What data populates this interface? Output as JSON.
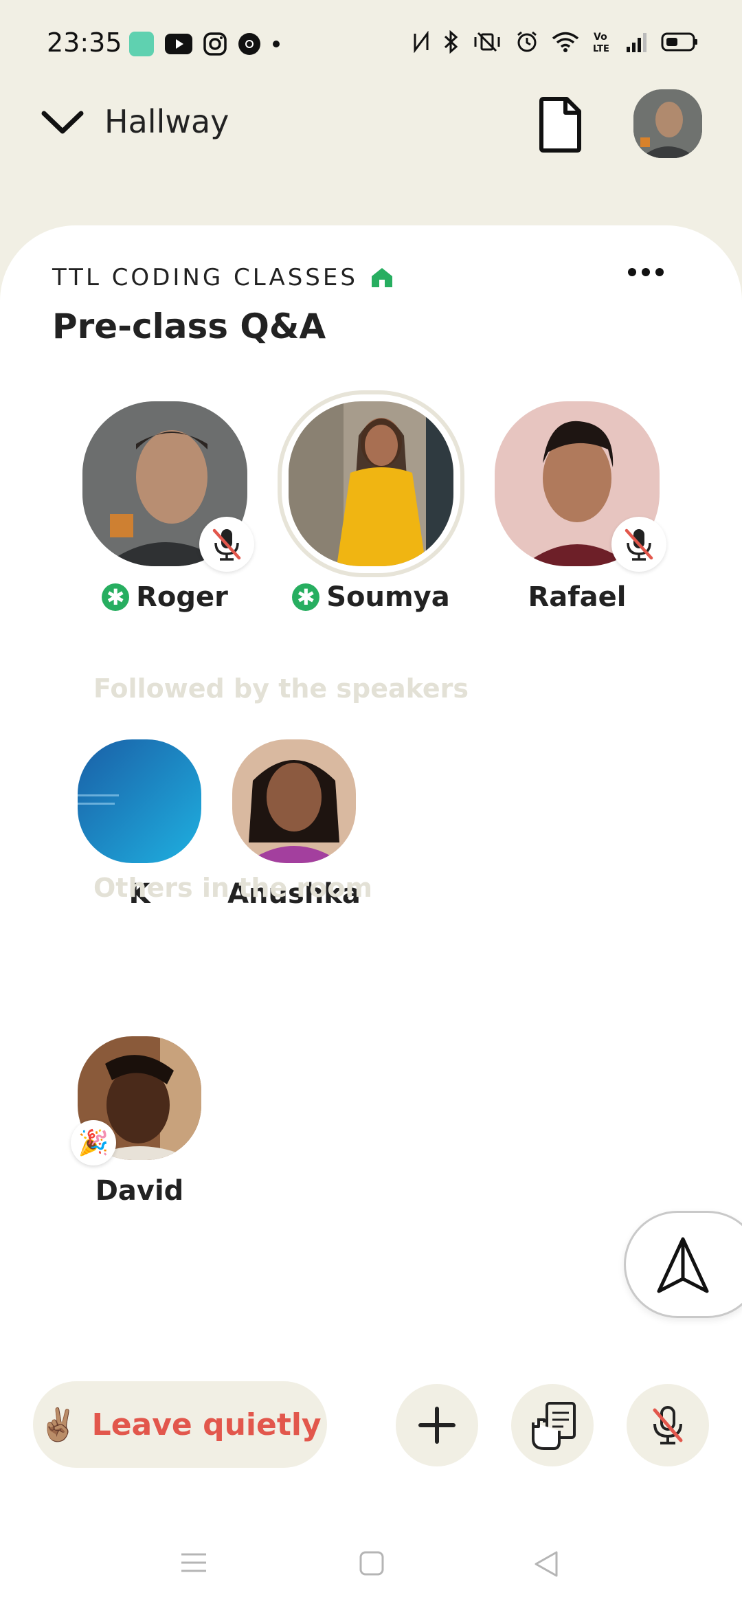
{
  "status_bar": {
    "time": "23:35",
    "app_icons": [
      "chat-app-icon",
      "youtube-icon",
      "instagram-icon",
      "chrome-icon",
      "more-dot-icon"
    ],
    "system_icons": [
      "nfc-icon",
      "bluetooth-icon",
      "vibrate-off-icon",
      "alarm-icon",
      "wifi-icon",
      "volte-icon",
      "signal-icon",
      "battery-icon"
    ]
  },
  "header": {
    "hallway_label": "Hallway"
  },
  "room": {
    "club_name": "TTL CODING CLASSES",
    "title": "Pre-class Q&A",
    "speakers": [
      {
        "name": "Roger",
        "moderator": true,
        "muted": true
      },
      {
        "name": "Soumya",
        "moderator": true,
        "muted": false,
        "speaking": true
      },
      {
        "name": "Rafael",
        "moderator": false,
        "muted": true
      }
    ],
    "followed_title": "Followed by the speakers",
    "followed": [
      {
        "name": "K"
      },
      {
        "name": "Anushka"
      }
    ],
    "others_title": "Others in the room",
    "others": [
      {
        "name": "David",
        "badge": "party-popper"
      }
    ]
  },
  "bottom_bar": {
    "leave_emoji": "✌🏽",
    "leave_label": "Leave quietly"
  },
  "colors": {
    "header_bg": "#f1efe4",
    "leave_text": "#e2574c",
    "moderator_green": "#27ae60",
    "section_title": "#e3e1d6"
  }
}
